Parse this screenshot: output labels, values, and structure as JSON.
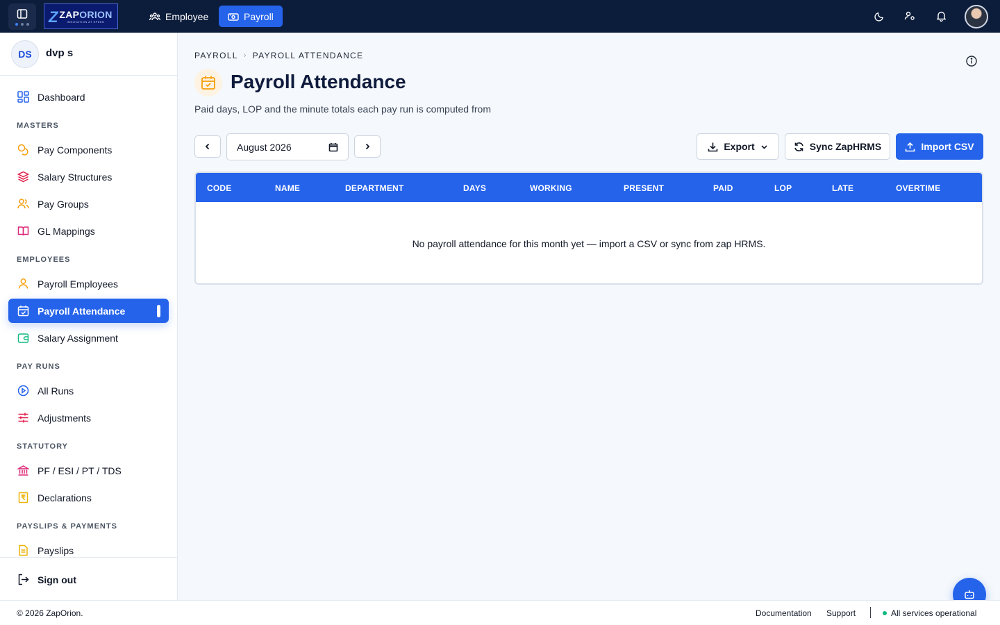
{
  "topbar": {
    "logo_text_a": "ZAP",
    "logo_text_b": "ORION",
    "logo_tagline": "INNOVATION AT SPEED",
    "tabs": [
      {
        "label": "Employee",
        "icon": "users-icon"
      },
      {
        "label": "Payroll",
        "icon": "money-icon",
        "active": true
      }
    ],
    "icons": [
      "theme-moon-icon",
      "user-settings-icon",
      "bell-icon"
    ]
  },
  "sidebar": {
    "user": {
      "initials": "DS",
      "name": "dvp s"
    },
    "dashboard": "Dashboard",
    "sections": {
      "masters": "MASTERS",
      "employees": "EMPLOYEES",
      "pay_runs": "PAY RUNS",
      "statutory": "STATUTORY",
      "payslips": "PAYSLIPS & PAYMENTS"
    },
    "items": {
      "pay_components": "Pay Components",
      "salary_structures": "Salary Structures",
      "pay_groups": "Pay Groups",
      "gl_mappings": "GL Mappings",
      "payroll_employees": "Payroll Employees",
      "payroll_attendance": "Payroll Attendance",
      "salary_assignment": "Salary Assignment",
      "all_runs": "All Runs",
      "adjustments": "Adjustments",
      "statutory": "PF / ESI / PT / TDS",
      "declarations": "Declarations",
      "payslips": "Payslips"
    },
    "sign_out": "Sign out"
  },
  "main": {
    "breadcrumb": [
      "PAYROLL",
      "PAYROLL ATTENDANCE"
    ],
    "title": "Payroll Attendance",
    "subtitle": "Paid days, LOP and the minute totals each pay run is computed from",
    "month_value": "August 2026",
    "buttons": {
      "export": "Export",
      "sync": "Sync ZapHRMS",
      "import": "Import CSV"
    },
    "table": {
      "columns": [
        "CODE",
        "NAME",
        "DEPARTMENT",
        "DAYS",
        "WORKING",
        "PRESENT",
        "PAID",
        "LOP",
        "LATE",
        "OVERTIME"
      ],
      "rows": [],
      "empty_message": "No payroll attendance for this month yet — import a CSV or sync from zap HRMS."
    }
  },
  "footer": {
    "copyright": "© 2026 ZapOrion.",
    "links": [
      "Documentation",
      "Support"
    ],
    "status": "All services operational"
  },
  "colors": {
    "topbar": "#0c1c3b",
    "accent": "#2563eb",
    "status_ok": "#10b981"
  }
}
